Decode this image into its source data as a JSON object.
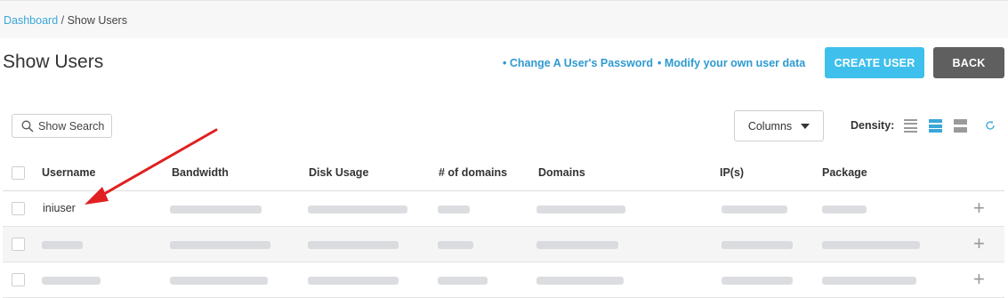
{
  "breadcrumb": {
    "home": "Dashboard",
    "separator": " / ",
    "current": "Show Users"
  },
  "page_title": "Show Users",
  "links": {
    "change_password": "• Change A User's Password",
    "modify_data": "• Modify your own user data"
  },
  "buttons": {
    "create_user": "CREATE USER",
    "back": "BACK"
  },
  "search": {
    "label": "Show Search"
  },
  "columns_button": {
    "label": "Columns"
  },
  "density": {
    "label": "Density:",
    "options": [
      "compact",
      "normal",
      "comfortable"
    ],
    "selected": "normal"
  },
  "table": {
    "headers": [
      "Username",
      "Bandwidth",
      "Disk Usage",
      "# of domains",
      "Domains",
      "IP(s)",
      "Package"
    ],
    "rows": [
      {
        "username": "iniuser"
      },
      {
        "username": ""
      },
      {
        "username": ""
      }
    ]
  },
  "colors": {
    "accent": "#3fc0ec",
    "link": "#2e9ad0",
    "back_button": "#5f5f5f",
    "annotation_arrow": "#e02020"
  },
  "icons": [
    "search-icon",
    "caret-down-icon",
    "density-compact-icon",
    "density-normal-icon",
    "density-comfortable-icon",
    "refresh-icon",
    "plus-icon",
    "annotation-arrow"
  ]
}
